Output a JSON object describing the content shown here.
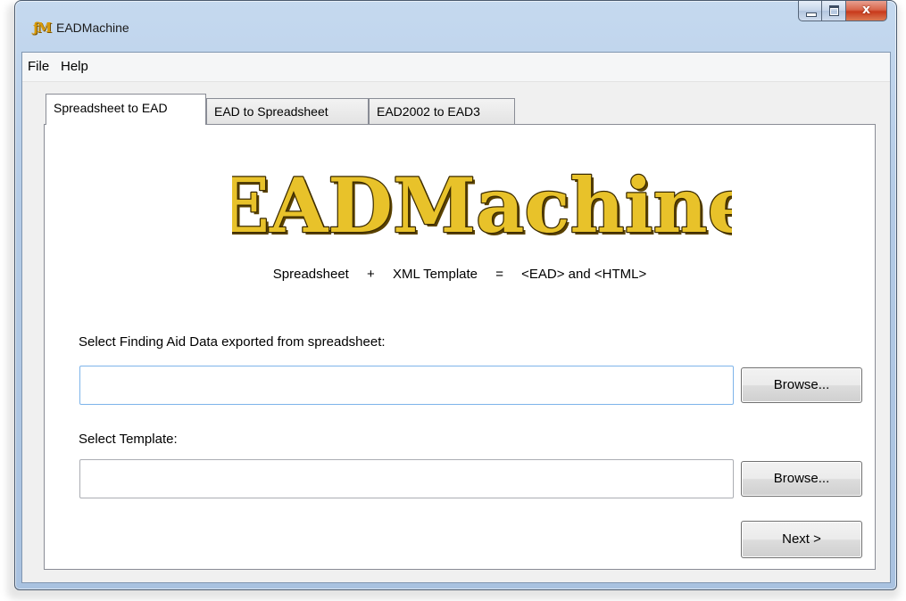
{
  "window": {
    "title": "EADMachine",
    "close_glyph": "x"
  },
  "menu": {
    "items": [
      "File",
      "Help"
    ]
  },
  "tabs": [
    {
      "label": "Spreadsheet to EAD",
      "active": true
    },
    {
      "label": "EAD to Spreadsheet",
      "active": false
    },
    {
      "label": "EAD2002 to EAD3",
      "active": false
    }
  ],
  "logo": {
    "text": "EADMachine",
    "color": "#e8c22a"
  },
  "formula": {
    "part1": "Spreadsheet",
    "op1": "+",
    "part2": "XML Template",
    "op2": "=",
    "part3": "<EAD> and <HTML>"
  },
  "form": {
    "data_label": "Select Finding Aid Data exported from spreadsheet:",
    "data_value": "",
    "template_label": "Select Template:",
    "template_value": "",
    "browse_label": "Browse...",
    "next_label": "Next >"
  },
  "icons": {
    "app": "eadmachine-app-icon",
    "minimize": "minimize-icon",
    "maximize": "maximize-icon",
    "close": "close-icon"
  }
}
